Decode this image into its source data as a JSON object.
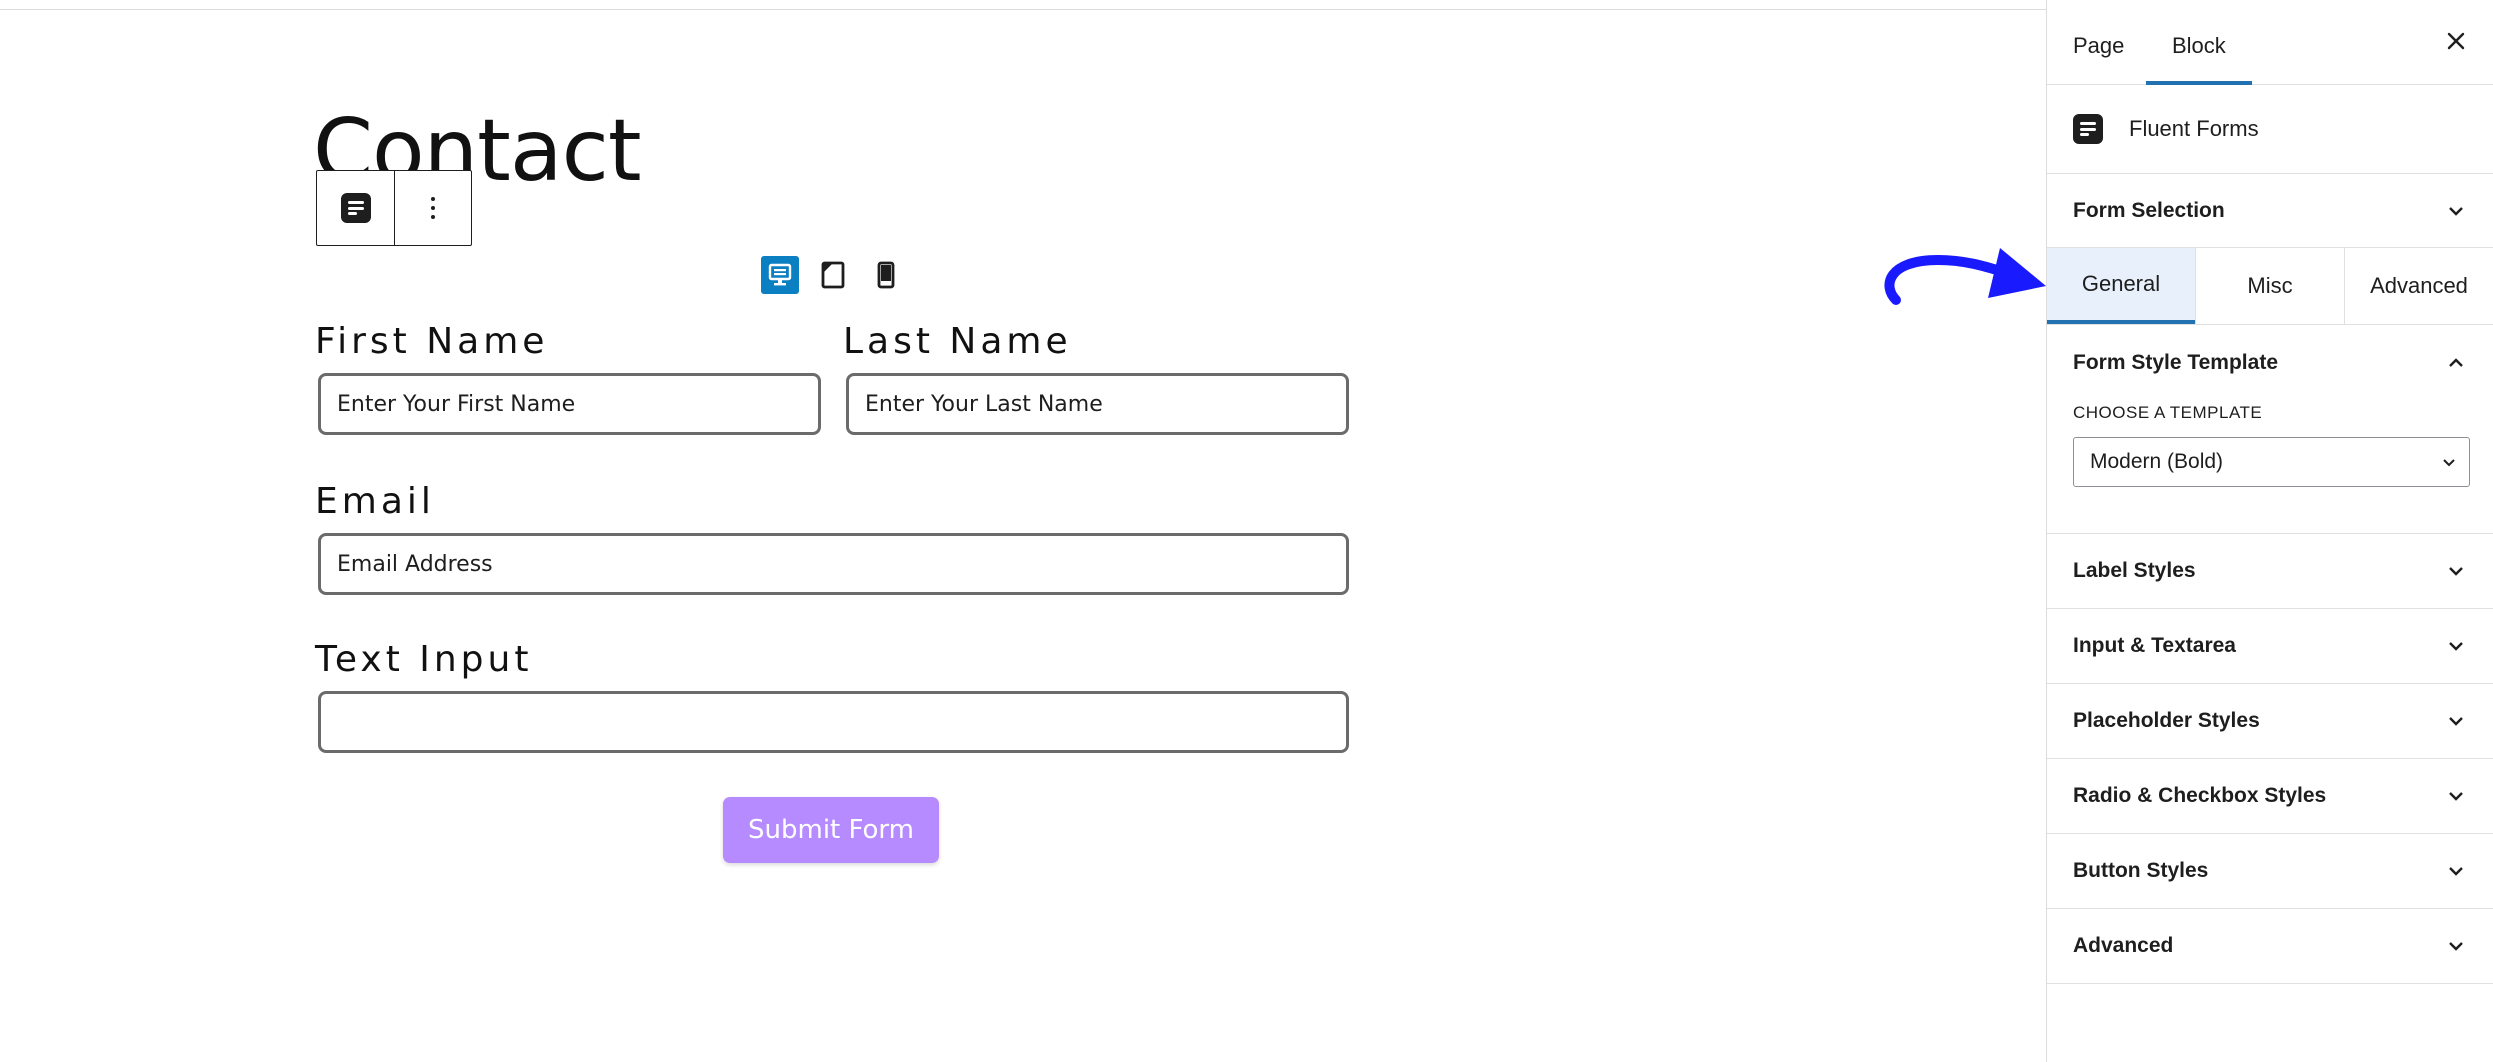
{
  "editor": {
    "page_title": "Contact",
    "form": {
      "first_name": {
        "label": "First Name",
        "placeholder": "Enter Your First Name"
      },
      "last_name": {
        "label": "Last Name",
        "placeholder": "Enter Your Last Name"
      },
      "email": {
        "label": "Email",
        "placeholder": "Email Address"
      },
      "text_input": {
        "label": "Text Input",
        "placeholder": ""
      },
      "submit_label": "Submit Form"
    },
    "device_preview": {
      "active": "desktop",
      "options": [
        "desktop",
        "tablet",
        "mobile"
      ]
    },
    "annotation_arrow_color": "#1a1aff"
  },
  "sidebar": {
    "tabs": [
      {
        "label": "Page"
      },
      {
        "label": "Block",
        "active": true
      }
    ],
    "block_name": "Fluent Forms",
    "form_selection": "Form Selection",
    "style_tabs": [
      {
        "label": "General",
        "active": true
      },
      {
        "label": "Misc"
      },
      {
        "label": "Advanced"
      }
    ],
    "form_style_template": {
      "title": "Form Style Template",
      "choose_label": "CHOOSE A TEMPLATE",
      "selected": "Modern (Bold)"
    },
    "panels": [
      {
        "title": "Label Styles"
      },
      {
        "title": "Input & Textarea"
      },
      {
        "title": "Placeholder Styles"
      },
      {
        "title": "Radio & Checkbox Styles"
      },
      {
        "title": "Button Styles"
      },
      {
        "title": "Advanced"
      }
    ]
  },
  "colors": {
    "accent": "#2271b1",
    "submit_button": "#b68bff",
    "device_active": "#0a7fc2"
  }
}
